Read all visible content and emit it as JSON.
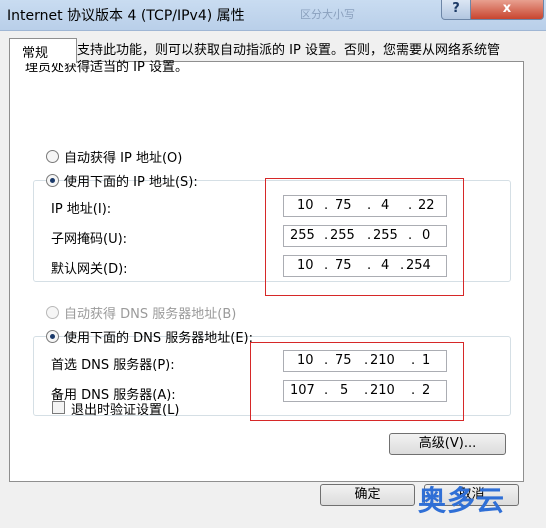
{
  "window": {
    "title": "Internet 协议版本 4 (TCP/IPv4) 属性",
    "ghost_text": "区分大小写",
    "help_label": "?",
    "close_label": "x"
  },
  "tab": {
    "label": "常规"
  },
  "description": "如果网络支持此功能，则可以获取自动指派的 IP 设置。否则，您需要从网络系统管理员处获得适当的 IP 设置。",
  "ip": {
    "auto_label": "自动获得 IP 地址(O)",
    "manual_label": "使用下面的 IP 地址(S):",
    "selected": "manual",
    "fields": [
      {
        "label": "IP 地址(I):",
        "octets": [
          "10",
          "75",
          "4",
          "22"
        ]
      },
      {
        "label": "子网掩码(U):",
        "octets": [
          "255",
          "255",
          "255",
          "0"
        ]
      },
      {
        "label": "默认网关(D):",
        "octets": [
          "10",
          "75",
          "4",
          "254"
        ]
      }
    ]
  },
  "dns": {
    "auto_label": "自动获得 DNS 服务器地址(B)",
    "manual_label": "使用下面的 DNS 服务器地址(E):",
    "selected": "manual",
    "fields": [
      {
        "label": "首选 DNS 服务器(P):",
        "octets": [
          "10",
          "75",
          "210",
          "1"
        ]
      },
      {
        "label": "备用 DNS 服务器(A):",
        "octets": [
          "107",
          "5",
          "210",
          "2"
        ]
      }
    ]
  },
  "validate": {
    "label": "退出时验证设置(L)",
    "checked": false
  },
  "buttons": {
    "advanced": "高级(V)...",
    "ok": "确定",
    "cancel": "取消"
  },
  "watermark": "奥多云",
  "colors": {
    "highlight_box": "#d62828",
    "title_bar": "#c9dcf1",
    "close_button": "#c8452f",
    "watermark": "#2f6fd6"
  }
}
